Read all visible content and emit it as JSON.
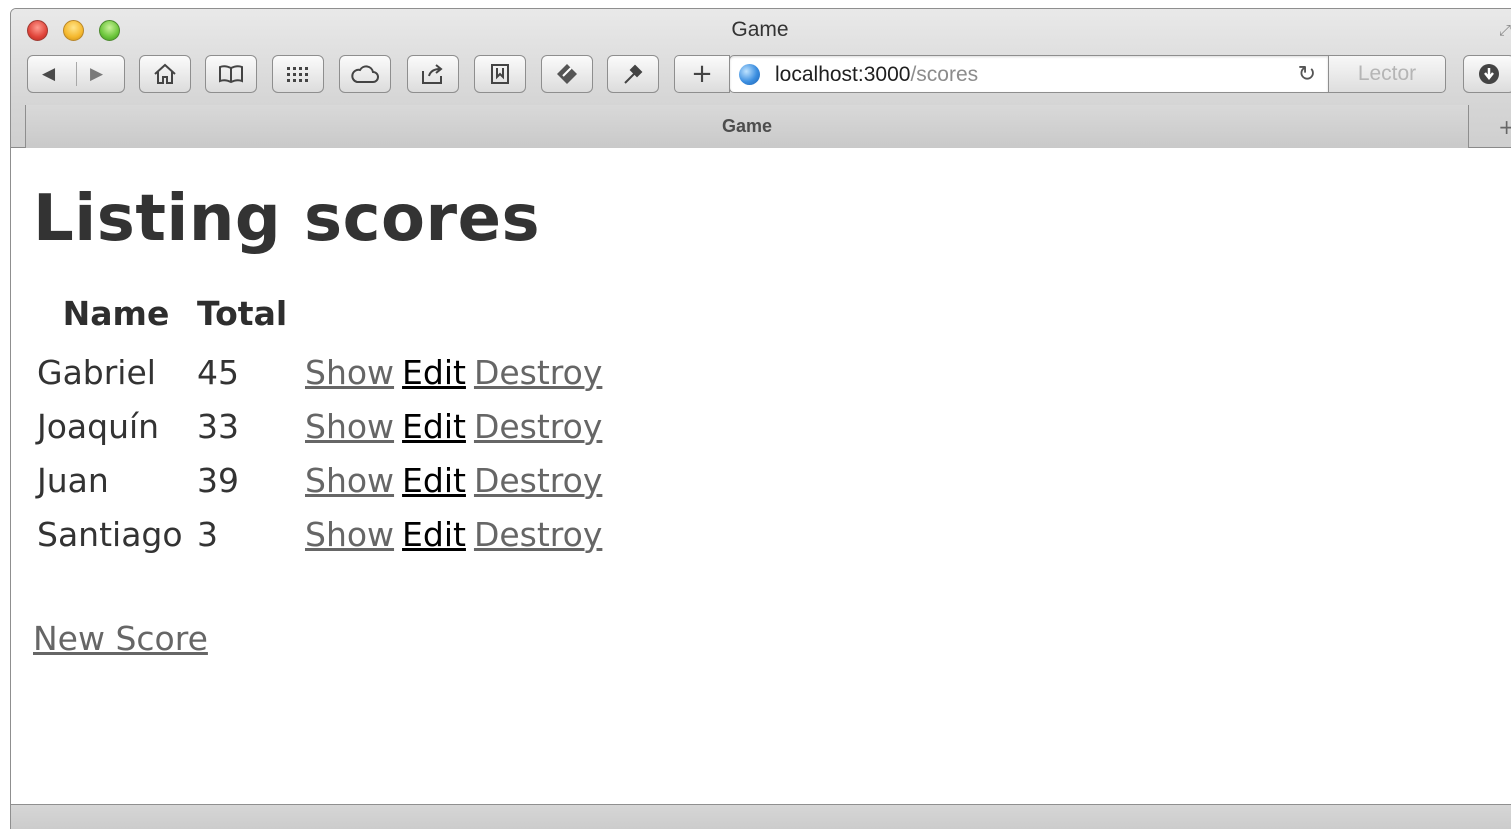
{
  "window": {
    "title": "Game",
    "url_host": "localhost:3000",
    "url_path": "/scores",
    "reader_label": "Lector",
    "tab_title": "Game"
  },
  "page": {
    "heading": "Listing scores",
    "columns": [
      "Name",
      "Total"
    ],
    "rows": [
      {
        "name": "Gabriel",
        "total": "45"
      },
      {
        "name": "Joaquín",
        "total": "33"
      },
      {
        "name": "Juan",
        "total": "39"
      },
      {
        "name": "Santiago",
        "total": "3"
      }
    ],
    "actions": {
      "show": "Show",
      "edit": "Edit",
      "destroy": "Destroy"
    },
    "new_link": "New Score"
  },
  "colors": {
    "heading": "#333333",
    "link": "#666666",
    "link_edit": "#000000"
  }
}
